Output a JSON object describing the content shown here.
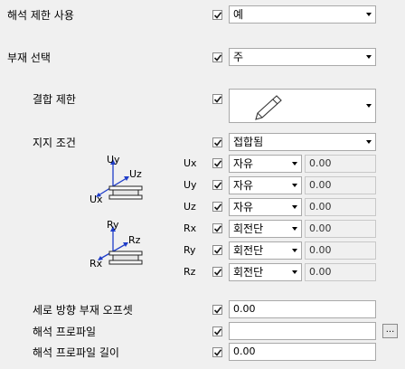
{
  "rows": {
    "analysis_limit": {
      "label": "해석 제한 사용",
      "value": "예"
    },
    "member_select": {
      "label": "부재 선택",
      "value": "주"
    },
    "connection_limit": {
      "label": "결합 제한"
    },
    "support_condition": {
      "label": "지지 조건",
      "value": "접합됨"
    }
  },
  "dofs": [
    {
      "label": "Ux",
      "option": "자유",
      "value": "0.00"
    },
    {
      "label": "Uy",
      "option": "자유",
      "value": "0.00"
    },
    {
      "label": "Uz",
      "option": "자유",
      "value": "0.00"
    },
    {
      "label": "Rx",
      "option": "회전단",
      "value": "0.00"
    },
    {
      "label": "Ry",
      "option": "회전단",
      "value": "0.00"
    },
    {
      "label": "Rz",
      "option": "회전단",
      "value": "0.00"
    }
  ],
  "diagram": {
    "translation": {
      "uy": "Uy",
      "uz": "Uz",
      "ux": "Ux"
    },
    "rotation": {
      "ry": "Ry",
      "rz": "Rz",
      "rx": "Rx"
    }
  },
  "bottom": {
    "vertical_offset": {
      "label": "세로 방향 부재 오프셋",
      "value": "0.00"
    },
    "profile": {
      "label": "해석 프로파일",
      "value": "",
      "browse": "..."
    },
    "profile_length": {
      "label": "해석 프로파일 길이",
      "value": "0.00"
    }
  },
  "colors": {
    "check": "#1a1a1a",
    "arrow": "#1e3cc8"
  }
}
